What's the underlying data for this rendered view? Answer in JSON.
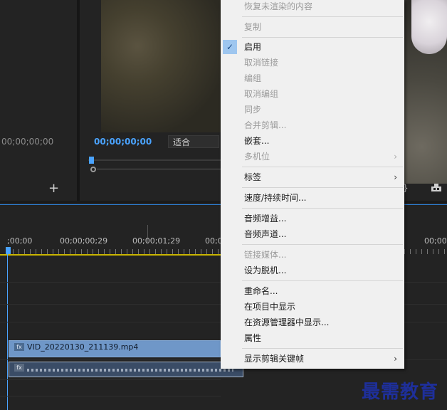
{
  "source_monitor": {
    "timecode": "00;00;00;00",
    "add_button_label": "+"
  },
  "program_monitor": {
    "timecode": "00;00;00;00",
    "fit_value": "适合",
    "right_controls_label": "}"
  },
  "timeline": {
    "ruler_labels": [
      ";00;00",
      "00;00;00;29",
      "00;00;01;29",
      "00;0",
      "00;00"
    ],
    "video_clip": {
      "fx_label": "fx",
      "name": "VID_20220130_211139.mp4"
    },
    "audio_clip": {
      "fx_label": "fx"
    }
  },
  "context_menu": {
    "items": [
      {
        "label": "恢复未渲染的内容",
        "enabled": false
      },
      {
        "label": "复制",
        "enabled": false
      },
      {
        "label": "启用",
        "enabled": true,
        "checked": true
      },
      {
        "label": "取消链接",
        "enabled": false
      },
      {
        "label": "编组",
        "enabled": false
      },
      {
        "label": "取消编组",
        "enabled": false
      },
      {
        "label": "同步",
        "enabled": false
      },
      {
        "label": "合并剪辑...",
        "enabled": false
      },
      {
        "label": "嵌套...",
        "enabled": true
      },
      {
        "label": "多机位",
        "enabled": false,
        "submenu": true
      },
      {
        "label": "标签",
        "enabled": true,
        "submenu": true
      },
      {
        "label": "速度/持续时间...",
        "enabled": true
      },
      {
        "label": "音频增益...",
        "enabled": true
      },
      {
        "label": "音频声道...",
        "enabled": true
      },
      {
        "label": "链接媒体...",
        "enabled": false
      },
      {
        "label": "设为脱机...",
        "enabled": true
      },
      {
        "label": "重命名...",
        "enabled": true
      },
      {
        "label": "在项目中显示",
        "enabled": true
      },
      {
        "label": "在资源管理器中显示...",
        "enabled": true
      },
      {
        "label": "属性",
        "enabled": true
      },
      {
        "label": "显示剪辑关键帧",
        "enabled": true,
        "submenu": true
      }
    ],
    "check_glyph": "✓",
    "submenu_glyph": "›"
  },
  "watermark": {
    "text": "最需教育"
  },
  "colors": {
    "accent_blue": "#4aa3ff",
    "menu_bg": "#f0f0f0",
    "ruler_yellow": "#c8b400",
    "clip_blue": "#6f97c8",
    "watermark": "#1e2f9a"
  }
}
